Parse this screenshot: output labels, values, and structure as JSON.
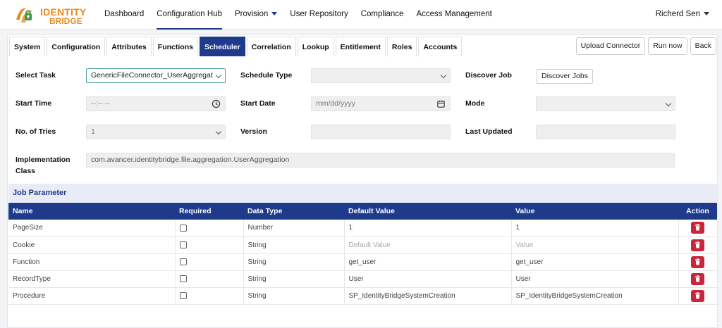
{
  "brand": {
    "line1": "IDENTITY",
    "line2": "BRIDGE"
  },
  "nav": {
    "dashboard": "Dashboard",
    "configuration_hub": "Configuration Hub",
    "provision": "Provision",
    "user_repository": "User Repository",
    "compliance": "Compliance",
    "access_management": "Access Management"
  },
  "user": {
    "name": "Richerd Sen"
  },
  "tabs": {
    "system": "System",
    "configuration": "Configuration",
    "attributes": "Attributes",
    "functions": "Functions",
    "scheduler": "Scheduler",
    "correlation": "Correlation",
    "lookup": "Lookup",
    "entitlement": "Entitlement",
    "roles": "Roles",
    "accounts": "Accounts"
  },
  "actions": {
    "upload_connector": "Upload Connector",
    "run_now": "Run now",
    "back": "Back"
  },
  "form": {
    "select_task_label": "Select Task",
    "select_task_value": "GenericFileConnector_UserAggregat",
    "schedule_type_label": "Schedule Type",
    "schedule_type_value": "",
    "discover_job_label": "Discover Job",
    "discover_jobs_button": "Discover Jobs",
    "start_time_label": "Start Time",
    "start_time_placeholder": "--:-- --",
    "start_date_label": "Start Date",
    "start_date_placeholder": "mm/dd/yyyy",
    "mode_label": "Mode",
    "mode_value": "",
    "tries_label": "No. of Tries",
    "tries_value": "1",
    "version_label": "Version",
    "version_value": "",
    "last_updated_label": "Last Updated",
    "last_updated_value": "",
    "impl_label_1": "Implementation",
    "impl_label_2": "Class",
    "impl_value": "com.avancer.identitybridge.file.aggregation.UserAggregation"
  },
  "job_parameter": {
    "title": "Job Parameter",
    "headers": {
      "name": "Name",
      "required": "Required",
      "data_type": "Data Type",
      "default_value": "Default Value",
      "value": "Value",
      "action": "Action"
    },
    "rows": [
      {
        "name": "PageSize",
        "data_type": "Number",
        "default_value": "1",
        "value": "1"
      },
      {
        "name": "Cookie",
        "data_type": "String",
        "default_value": "Default Value",
        "value": "Value"
      },
      {
        "name": "Function",
        "data_type": "String",
        "default_value": "get_user",
        "value": "get_user"
      },
      {
        "name": "RecordType",
        "data_type": "String",
        "default_value": "User",
        "value": "User"
      },
      {
        "name": "Procedure",
        "data_type": "String",
        "default_value": "SP_IdentityBridgeSystemCreation",
        "value": "SP_IdentityBridgeSystemCreation"
      }
    ]
  },
  "colors": {
    "primary": "#1e3a8a",
    "brand_orange": "#e8891f",
    "delete_red": "#c8263a",
    "section_bg": "#e9ecf7"
  }
}
